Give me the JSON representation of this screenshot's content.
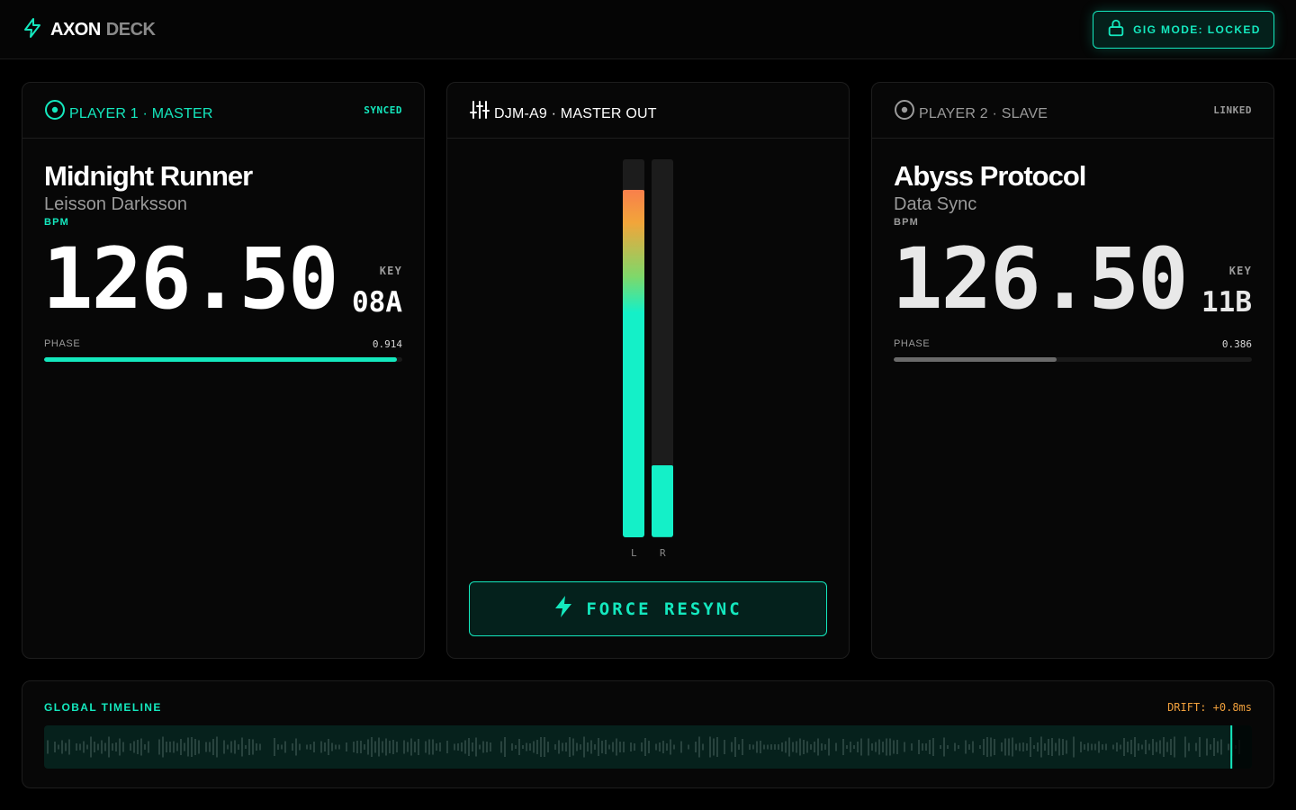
{
  "header": {
    "brand_primary": "AXON",
    "brand_secondary": "DECK",
    "gig_mode_label": "GIG MODE: LOCKED"
  },
  "colors": {
    "accent": "#14e8be",
    "warning": "#f0a03c",
    "muted": "#9a9a9a",
    "panel_bg": "#070707"
  },
  "player1": {
    "title": "PLAYER 1 · MASTER",
    "status": "SYNCED",
    "track": "Midnight Runner",
    "artist": "Leisson Darksson",
    "bpm_label": "BPM",
    "bpm": "126.50",
    "key_label": "KEY",
    "key": "08A",
    "phase_label": "PHASE",
    "phase": "0.914",
    "phase_fraction": 0.985,
    "icon": "disc-icon"
  },
  "mixer": {
    "title": "DJM-A9 · MASTER OUT",
    "icon": "sliders-icon",
    "left_label": "L",
    "right_label": "R",
    "left_level": 0.92,
    "right_level": 0.19,
    "resync_label": "FORCE RESYNC"
  },
  "player2": {
    "title": "PLAYER 2 · SLAVE",
    "status": "LINKED",
    "track": "Abyss Protocol",
    "artist": "Data Sync",
    "bpm_label": "BPM",
    "bpm": "126.50",
    "key_label": "KEY",
    "key": "11B",
    "phase_label": "PHASE",
    "phase": "0.386",
    "phase_fraction": 0.455,
    "icon": "disc-icon"
  },
  "timeline": {
    "title": "GLOBAL TIMELINE",
    "drift": "DRIFT: +0.8ms",
    "playhead_fraction": 0.983
  }
}
